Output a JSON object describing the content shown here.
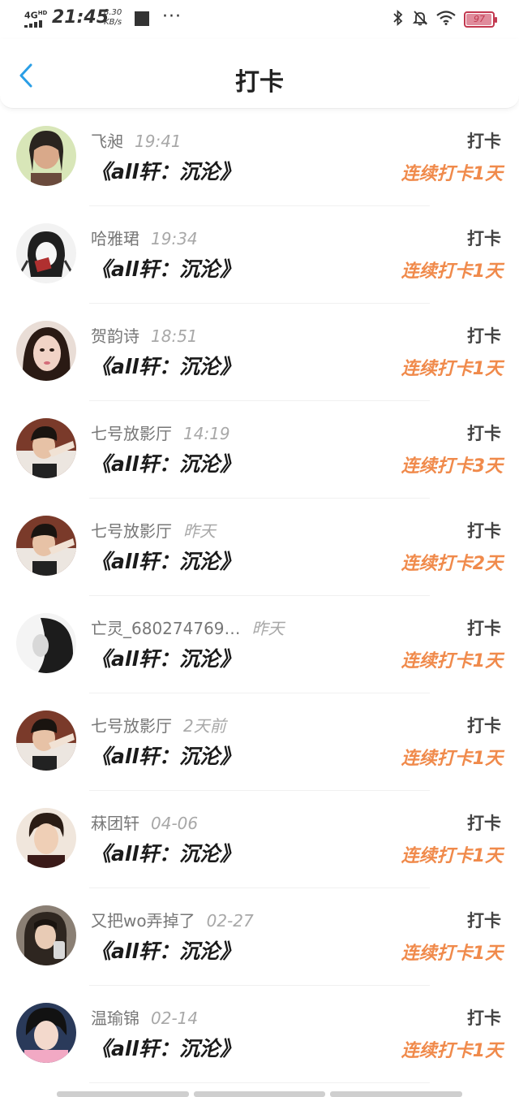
{
  "status_bar": {
    "network": "4G",
    "network_sup": "HD",
    "time": "21:45",
    "speed_value": "8.30",
    "speed_unit": "KB/s",
    "dots": "···",
    "battery": "97"
  },
  "header": {
    "title": "打卡",
    "back_icon": "chevron-left-icon",
    "accent_color": "#2a9ee6"
  },
  "colors": {
    "streak": "#f08a4b",
    "name": "#777777",
    "time": "#a8a8a8"
  },
  "entries": [
    {
      "name": "飞昶",
      "time": "19:41",
      "book": "《all轩：沉沦》",
      "action": "打卡",
      "streak": "连续打卡1天"
    },
    {
      "name": "哈雅珺",
      "time": "19:34",
      "book": "《all轩：沉沦》",
      "action": "打卡",
      "streak": "连续打卡1天"
    },
    {
      "name": "贺韵诗",
      "time": "18:51",
      "book": "《all轩：沉沦》",
      "action": "打卡",
      "streak": "连续打卡1天"
    },
    {
      "name": "七号放影厅",
      "time": "14:19",
      "book": "《all轩：沉沦》",
      "action": "打卡",
      "streak": "连续打卡3天"
    },
    {
      "name": "七号放影厅",
      "time": "昨天",
      "book": "《all轩：沉沦》",
      "action": "打卡",
      "streak": "连续打卡2天"
    },
    {
      "name": "亡灵_680274769…",
      "time": "昨天",
      "book": "《all轩：沉沦》",
      "action": "打卡",
      "streak": "连续打卡1天"
    },
    {
      "name": "七号放影厅",
      "time": "2天前",
      "book": "《all轩：沉沦》",
      "action": "打卡",
      "streak": "连续打卡1天"
    },
    {
      "name": "菻团轩",
      "time": "04-06",
      "book": "《all轩：沉沦》",
      "action": "打卡",
      "streak": "连续打卡1天"
    },
    {
      "name": "又把wo弄掉了",
      "time": "02-27",
      "book": "《all轩：沉沦》",
      "action": "打卡",
      "streak": "连续打卡1天"
    },
    {
      "name": "温瑜锦",
      "time": "02-14",
      "book": "《all轩：沉沦》",
      "action": "打卡",
      "streak": "连续打卡1天"
    }
  ]
}
